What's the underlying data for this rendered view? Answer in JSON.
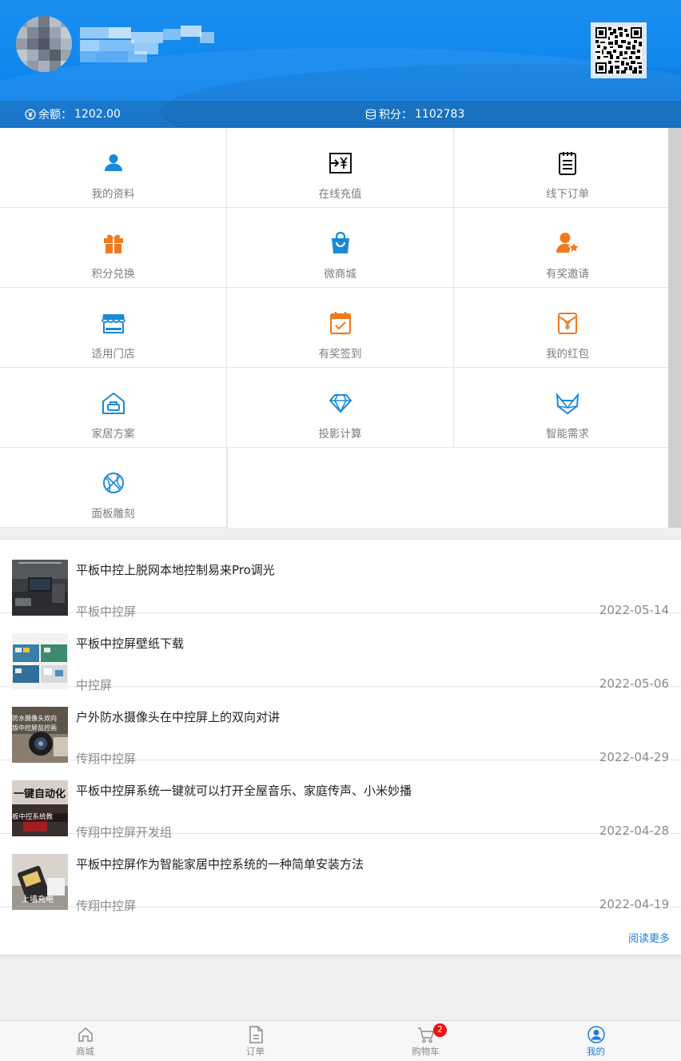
{
  "header": {
    "balance_label": "余额：",
    "balance_value": "1202.00",
    "points_label": "积分：",
    "points_value": "1102783"
  },
  "menu": {
    "items": [
      {
        "label": "我的资料",
        "icon": "user-icon",
        "color": "#1a8ad8"
      },
      {
        "label": "在线充值",
        "icon": "recharge-icon",
        "color": "#111111"
      },
      {
        "label": "线下订单",
        "icon": "notepad-icon",
        "color": "#111111"
      },
      {
        "label": "积分兑换",
        "icon": "gift-icon",
        "color": "#f07a1e"
      },
      {
        "label": "微商城",
        "icon": "shopping-bag-icon",
        "color": "#1a8ad8"
      },
      {
        "label": "有奖邀请",
        "icon": "user-star-icon",
        "color": "#f07a1e"
      },
      {
        "label": "适用门店",
        "icon": "store-icon",
        "color": "#1a8ad8"
      },
      {
        "label": "有奖签到",
        "icon": "calendar-check-icon",
        "color": "#f07a1e"
      },
      {
        "label": "我的红包",
        "icon": "red-envelope-icon",
        "color": "#f07a1e"
      },
      {
        "label": "家居方案",
        "icon": "home-sofa-icon",
        "color": "#1a8ad8"
      },
      {
        "label": "投影计算",
        "icon": "diamond-icon",
        "color": "#1a8ad8"
      },
      {
        "label": "智能需求",
        "icon": "fox-icon",
        "color": "#1a8ad8"
      },
      {
        "label": "面板雕刻",
        "icon": "basketball-icon",
        "color": "#1a8ad8"
      }
    ]
  },
  "news": {
    "items": [
      {
        "title": "平板中控上脱网本地控制易来Pro调光",
        "category": "平板中控屏",
        "date": "2022-05-14"
      },
      {
        "title": "平板中控屏壁纸下载",
        "category": "中控屏",
        "date": "2022-05-06"
      },
      {
        "title": "户外防水摄像头在中控屏上的双向对讲",
        "category": "传翔中控屏",
        "date": "2022-04-29"
      },
      {
        "title": "平板中控屏系统一键就可以打开全屋音乐、家庭传声、小米妙播",
        "category": "传翔中控屏开发组",
        "date": "2022-04-28"
      },
      {
        "title": "平板中控屏作为智能家居中控系统的一种简单安装方法",
        "category": "传翔中控屏",
        "date": "2022-04-19"
      }
    ],
    "thumb_texts": [
      "防水摄像头双向",
      "版中控屏监控画",
      "一键自动化",
      "板中控系统教",
      "上墙充电"
    ],
    "read_more": "阅读更多"
  },
  "tabbar": {
    "items": [
      {
        "label": "商城",
        "icon": "house-icon"
      },
      {
        "label": "订单",
        "icon": "document-icon"
      },
      {
        "label": "购物车",
        "icon": "cart-icon",
        "badge": "2"
      },
      {
        "label": "我的",
        "icon": "profile-icon",
        "active": true
      }
    ]
  },
  "colors": {
    "header_blue": "#0f86ee",
    "accent_blue": "#1a7fd8",
    "accent_orange": "#f07a1e",
    "badge_red": "#ee1111"
  }
}
